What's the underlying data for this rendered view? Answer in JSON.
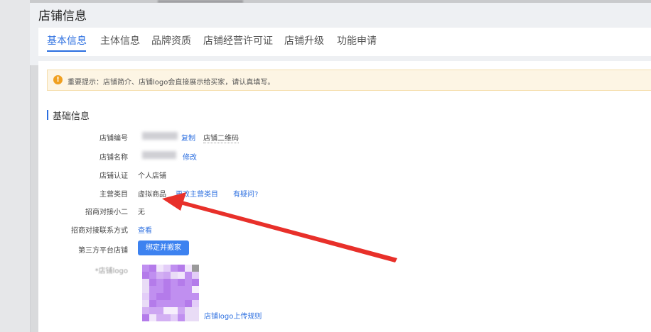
{
  "header": {
    "title": "店铺信息"
  },
  "tabs": [
    {
      "label": "基本信息",
      "active": true
    },
    {
      "label": "主体信息"
    },
    {
      "label": "品牌资质"
    },
    {
      "label": "店铺经营许可证"
    },
    {
      "label": "店铺升级"
    },
    {
      "label": "功能申请"
    }
  ],
  "notice": {
    "icon": "warning-icon",
    "text": "重要提示：店铺简介、店铺logo会直接展示给买家，请认真填写。"
  },
  "section": {
    "title": "基础信息"
  },
  "fields": {
    "shop_id": {
      "label": "店铺编号",
      "copy": "复制",
      "qrcode": "店铺二维码"
    },
    "shop_name": {
      "label": "店铺名称",
      "modify": "修改"
    },
    "certification": {
      "label": "店铺认证",
      "value": "个人店铺"
    },
    "category": {
      "label": "主营类目",
      "value": "虚拟商品",
      "change": "更改主营类目",
      "question": "有疑问?"
    },
    "contact_person": {
      "label": "招商对接小二",
      "value": "无"
    },
    "contact_method": {
      "label": "招商对接联系方式",
      "view": "查看"
    },
    "third_party": {
      "label": "第三方平台店铺",
      "button": "绑定并搬家"
    },
    "logo": {
      "label": "*店铺logo",
      "rules": "店铺logo上传规则"
    }
  },
  "colors": {
    "accent": "#2c6fe0",
    "button": "#3d82f0",
    "warning": "#f0a020",
    "arrow": "#e8302a"
  }
}
